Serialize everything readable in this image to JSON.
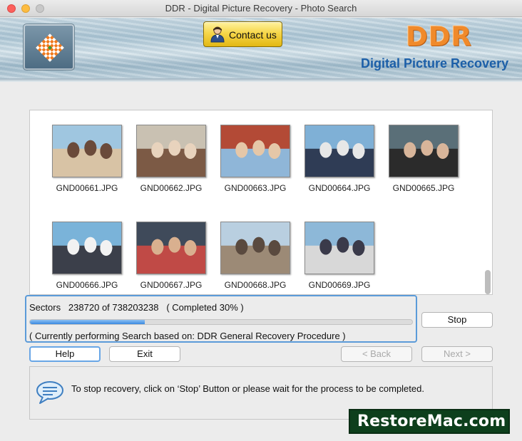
{
  "window": {
    "title": "DDR - Digital Picture Recovery - Photo Search"
  },
  "header": {
    "contact_label": "Contact us",
    "brand_main": "DDR",
    "brand_sub": "Digital Picture Recovery"
  },
  "gallery": {
    "items": [
      {
        "name": "GND00661.JPG",
        "palette": [
          "#9fc6e0",
          "#d8c3a5",
          "#6a4a3a"
        ]
      },
      {
        "name": "GND00662.JPG",
        "palette": [
          "#c9c1b2",
          "#7c5a45",
          "#e8d3bd"
        ]
      },
      {
        "name": "GND00663.JPG",
        "palette": [
          "#b34a36",
          "#8fb6d8",
          "#e5c7a8"
        ]
      },
      {
        "name": "GND00664.JPG",
        "palette": [
          "#7fb0d6",
          "#2f3c55",
          "#e7e7e7"
        ]
      },
      {
        "name": "GND00665.JPG",
        "palette": [
          "#5a6f78",
          "#2b2b2b",
          "#d8b59a"
        ]
      },
      {
        "name": "GND00666.JPG",
        "palette": [
          "#7ab3d9",
          "#3b3f4a",
          "#f2f2f2"
        ]
      },
      {
        "name": "GND00667.JPG",
        "palette": [
          "#3f4a5a",
          "#c04a46",
          "#d9b08f"
        ]
      },
      {
        "name": "GND00668.JPG",
        "palette": [
          "#b9cfe0",
          "#9c8a76",
          "#5a4a3f"
        ]
      },
      {
        "name": "GND00669.JPG",
        "palette": [
          "#8db8d8",
          "#d8d8d8",
          "#3a3a4a"
        ]
      }
    ]
  },
  "progress": {
    "sectors_label": "Sectors",
    "current": "238720",
    "of_label": "of",
    "total": "738203238",
    "completed_text": "( Completed 30% )",
    "percent": 30,
    "status": "( Currently performing Search based on: DDR General Recovery Procedure )"
  },
  "buttons": {
    "stop": "Stop",
    "help": "Help",
    "exit": "Exit",
    "back": "< Back",
    "next": "Next >"
  },
  "info": {
    "message": "To stop recovery, click on ‘Stop’ Button or please wait for the process to be completed."
  },
  "watermark": "RestoreMac.com"
}
